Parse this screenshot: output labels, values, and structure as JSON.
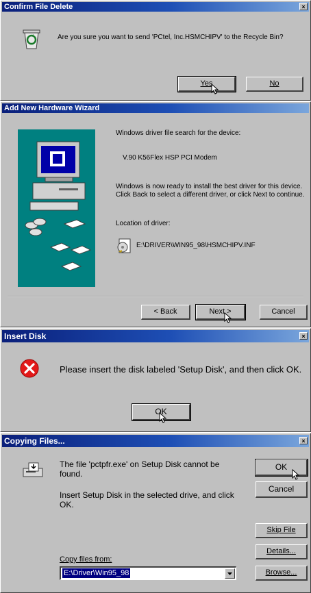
{
  "d1": {
    "title": "Confirm File Delete",
    "message": "Are you sure you want to send 'PCtel, Inc.HSMCHIPV' to the Recycle Bin?",
    "yes": "Yes",
    "no": "No"
  },
  "d2": {
    "title": "Add New Hardware Wizard",
    "line1": "Windows driver file search for the device:",
    "device": "V.90 K56Flex HSP PCI Modem",
    "line2": "Windows is now ready to install the best driver for this device. Click Back to select a different driver, or click Next to continue.",
    "loc_label": "Location of driver:",
    "loc_path": "E:\\DRIVER\\WIN95_98\\HSMCHIPV.INF",
    "back": "< Back",
    "next": "Next >",
    "cancel": "Cancel"
  },
  "d3": {
    "title": "Insert Disk",
    "message": "Please insert the disk labeled 'Setup Disk', and then click OK.",
    "ok": "OK"
  },
  "d4": {
    "title": "Copying Files...",
    "msg1": "The file 'pctpfr.exe' on Setup Disk cannot be found.",
    "msg2": "Insert Setup Disk in the selected drive, and click OK.",
    "copy_label": "Copy files from:",
    "copy_value": "E:\\Driver\\Win95_98",
    "ok": "OK",
    "cancel": "Cancel",
    "skip": "Skip File",
    "details": "Details...",
    "browse": "Browse..."
  }
}
